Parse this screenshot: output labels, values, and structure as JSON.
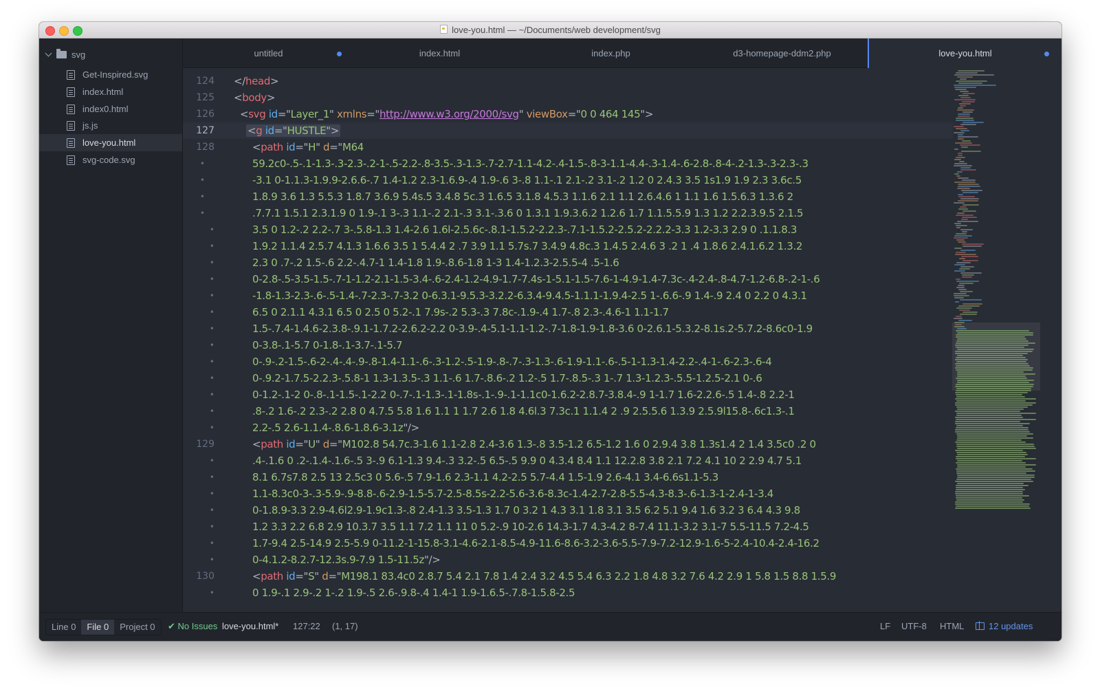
{
  "window": {
    "title": "love-you.html — ~/Documents/web development/svg"
  },
  "sidebar": {
    "root": "svg",
    "items": [
      {
        "label": "Get-Inspired.svg"
      },
      {
        "label": "index.html"
      },
      {
        "label": "index0.html"
      },
      {
        "label": "js.js"
      },
      {
        "label": "love-you.html",
        "selected": true
      },
      {
        "label": "svg-code.svg"
      }
    ]
  },
  "tabs": [
    {
      "label": "untitled",
      "modified": true
    },
    {
      "label": "index.html"
    },
    {
      "label": "index.php"
    },
    {
      "label": "d3-homepage-ddm2.php"
    },
    {
      "label": "love-you.html",
      "modified": true,
      "active": true
    }
  ],
  "editor": {
    "gutter": [
      "124",
      "125",
      "126",
      "127",
      "128",
      "129",
      "130"
    ],
    "current_line": "127",
    "lines": {
      "l0": [
        {
          "cls": "p",
          "text": "</"
        },
        {
          "cls": "t",
          "text": "head"
        },
        {
          "cls": "p",
          "text": ">"
        }
      ],
      "l1": [
        {
          "cls": "p",
          "text": "<"
        },
        {
          "cls": "t",
          "text": "body"
        },
        {
          "cls": "p",
          "text": ">"
        }
      ],
      "l2": [
        {
          "cls": "p",
          "text": "<"
        },
        {
          "cls": "t",
          "text": "svg "
        },
        {
          "cls": "id",
          "text": "id"
        },
        {
          "cls": "p",
          "text": "=\""
        },
        {
          "cls": "g",
          "text": "Layer_1"
        },
        {
          "cls": "p",
          "text": "\" "
        },
        {
          "cls": "a",
          "text": "xmlns"
        },
        {
          "cls": "p",
          "text": "=\""
        },
        {
          "cls": "u",
          "text": "http://www.w3.org/2000/svg"
        },
        {
          "cls": "p",
          "text": "\" "
        },
        {
          "cls": "a",
          "text": "viewBox"
        },
        {
          "cls": "p",
          "text": "=\""
        },
        {
          "cls": "g",
          "text": "0 0 464 145"
        },
        {
          "cls": "p",
          "text": "\">"
        }
      ],
      "l3": [
        {
          "cls": "p",
          "text": "<"
        },
        {
          "cls": "t",
          "text": "g "
        },
        {
          "cls": "id",
          "text": "id"
        },
        {
          "cls": "p",
          "text": "=\""
        },
        {
          "cls": "g",
          "text": "HUSTLE"
        },
        {
          "cls": "p",
          "text": "\">"
        }
      ],
      "l4": [
        {
          "cls": "p",
          "text": "<"
        },
        {
          "cls": "t",
          "text": "path "
        },
        {
          "cls": "id",
          "text": "id"
        },
        {
          "cls": "p",
          "text": "=\""
        },
        {
          "cls": "g",
          "text": "H"
        },
        {
          "cls": "p",
          "text": "\" "
        },
        {
          "cls": "a",
          "text": "d"
        },
        {
          "cls": "p",
          "text": "=\""
        },
        {
          "cls": "g",
          "text": "M64"
        }
      ],
      "l5": [
        {
          "cls": "g",
          "text": "59.2c0-.5-.1-1.3-.3-2.3-.2-1-.5-2.2-.8-3.5-.3-1.3-.7-2.7-1.1-4.2-.4-1.5-.8-3-1.1-4.4-.3-1.4-.6-2.8-.8-4-.2-1.3-.3-2.3-.3"
        }
      ],
      "l6": [
        {
          "cls": "g",
          "text": "-3.1 0-1.1.3-1.9.9-2.6.6-.7 1.4-1.2 2.3-1.6.9-.4 1.9-.6 3-.8 1.1-.1 2.1-.2 3.1-.2 1.2 0 2.4.3 3.5 1s1.9 1.9 2.3 3.6c.5"
        }
      ],
      "l7": [
        {
          "cls": "g",
          "text": "1.8.9 3.6 1.3 5.5.3 1.8.7 3.6.9 5.4s.5 3.4.8 5c.3 1.6.5 3.1.8 4.5.3 1.1.6 2.1 1.1 2.6.4.6 1 1.1 1.6 1.5.6.3 1.3.6 2"
        }
      ],
      "l8": [
        {
          "cls": "g",
          "text": ".7.7.1 1.5.1 2.3.1.9 0 1.9-.1 3-.3 1.1-.2 2.1-.3 3.1-.3.6 0 1.3.1 1.9.3.6.2 1.2.6 1.7 1.1.5.5.9 1.3 1.2 2.2.3.9.5 2.1.5"
        }
      ],
      "l9": [
        {
          "cls": "g",
          "text": "3.5 0 1.2-.2 2.2-.7 3-.5.8-1.3 1.4-2.6 1.6l-2.5.6c-.8.1-1.5.2-2.2.3-.7.1-1.5.2-2.5.2-2.2.2-3.3 1.2-3.3 2.9 0 .1.1.8.3"
        }
      ],
      "l10": [
        {
          "cls": "g",
          "text": "1.9.2 1.1.4 2.5.7 4.1.3 1.6.6 3.5 1 5.4.4 2 .7 3.9 1.1 5.7s.7 3.4.9 4.8c.3 1.4.5 2.4.6 3 .2 1 .4 1.8.6 2.4.1.6.2 1.3.2"
        }
      ],
      "l11": [
        {
          "cls": "g",
          "text": "2.3 0 .7-.2 1.5-.6 2.2-.4.7-1 1.4-1.8 1.9-.8.6-1.8 1-3 1.4-1.2.3-2.5.5-4 .5-1.6"
        }
      ],
      "l12": [
        {
          "cls": "g",
          "text": "0-2.8-.5-3.5-1.5-.7-1-1.2-2.1-1.5-3.4-.6-2.4-1.2-4.9-1.7-7.4s-1-5.1-1.5-7.6-1-4.9-1.4-7.3c-.4-2.4-.8-4.7-1.2-6.8-.2-1-.6"
        }
      ],
      "l13": [
        {
          "cls": "g",
          "text": "-1.8-1.3-2.3-.6-.5-1.4-.7-2.3-.7-3.2 0-6.3.1-9.5.3-3.2.2-6.3.4-9.4.5-1.1.1-1.9.4-2.5 1-.6.6-.9 1.4-.9 2.4 0 2.2 0 4.3.1"
        }
      ],
      "l14": [
        {
          "cls": "g",
          "text": "6.5 0 2.1.1 4.3.1 6.5 0 2.5 0 5.2-.1 7.9s-.2 5.3-.3 7.8c-.1.9-.4 1.7-.8 2.3-.4.6-1 1.1-1.7"
        }
      ],
      "l15": [
        {
          "cls": "g",
          "text": "1.5-.7.4-1.4.6-2.3.8-.9.1-1.7.2-2.6.2-2.2 0-3.9-.4-5.1-1.1-1.2-.7-1.8-1.9-1.8-3.6 0-2.6.1-5.3.2-8.1s.2-5.7.2-8.6c0-1.9"
        }
      ],
      "l16": [
        {
          "cls": "g",
          "text": "0-3.8-.1-5.7 0-1.8-.1-3.7-.1-5.7"
        }
      ],
      "l17": [
        {
          "cls": "g",
          "text": "0-.9-.2-1.5-.6-2-.4-.4-.9-.8-1.4-1.1-.6-.3-1.2-.5-1.9-.8-.7-.3-1.3-.6-1.9-1.1-.6-.5-1-1.3-1.4-2.2-.4-1-.6-2.3-.6-4"
        }
      ],
      "l18": [
        {
          "cls": "g",
          "text": "0-.9.2-1.7.5-2.2.3-.5.8-1 1.3-1.3.5-.3 1.1-.6 1.7-.8.6-.2 1.2-.5 1.7-.8.5-.3 1-.7 1.3-1.2.3-.5.5-1.2.5-2.1 0-.6"
        }
      ],
      "l19": [
        {
          "cls": "g",
          "text": "0-1.2-.1-2 0-.8-.1-1.5-.1-2.2 0-.7-.1-1.3-.1-1.8s-.1-.9-.1-1.1c0-1.6.2-2.8.7-3.8.4-.9 1-1.7 1.6-2.2.6-.5 1.4-.8 2.2-1"
        }
      ],
      "l20": [
        {
          "cls": "g",
          "text": ".8-.2 1.6-.2 2.3-.2 2.8 0 4.7.5 5.8 1.6 1.1 1 1.7 2.6 1.8 4.6l.3 7.3c.1 1.1.4 2 .9 2.5.5.6 1.3.9 2.5.9l15.8-.6c1.3-.1"
        }
      ],
      "l21": [
        {
          "cls": "g",
          "text": "2.2-.5 2.6-1.1.4-.8.6-1.8.6-3.1z"
        },
        {
          "cls": "p",
          "text": "\"/>"
        }
      ],
      "l22": [
        {
          "cls": "p",
          "text": "<"
        },
        {
          "cls": "t",
          "text": "path "
        },
        {
          "cls": "id",
          "text": "id"
        },
        {
          "cls": "p",
          "text": "=\""
        },
        {
          "cls": "g",
          "text": "U"
        },
        {
          "cls": "p",
          "text": "\" "
        },
        {
          "cls": "a",
          "text": "d"
        },
        {
          "cls": "p",
          "text": "=\""
        },
        {
          "cls": "g",
          "text": "M102.8 54.7c.3-1.6 1.1-2.8 2.4-3.6 1.3-.8 3.5-1.2 6.5-1.2 1.6 0 2.9.4 3.8 1.3s1.4 2 1.4 3.5c0 .2 0"
        }
      ],
      "l23": [
        {
          "cls": "g",
          "text": ".4-.1.6 0 .2-.1.4-.1.6-.5 3-.9 6.1-1.3 9.4-.3 3.2-.5 6.5-.5 9.9 0 4.3.4 8.4 1.1 12.2.8 3.8 2.1 7.2 4.1 10 2 2.9 4.7 5.1"
        }
      ],
      "l24": [
        {
          "cls": "g",
          "text": "8.1 6.7s7.8 2.5 13 2.5c3 0 5.6-.5 7.9-1.6 2.3-1.1 4.2-2.5 5.7-4.4 1.5-1.9 2.6-4.1 3.4-6.6s1.1-5.3"
        }
      ],
      "l25": [
        {
          "cls": "g",
          "text": "1.1-8.3c0-3-.3-5.9-.9-8.8-.6-2.9-1.5-5.7-2.5-8.5s-2.2-5.6-3.6-8.3c-1.4-2.7-2.8-5.5-4.3-8.3-.6-1.3-1-2.4-1-3.4"
        }
      ],
      "l26": [
        {
          "cls": "g",
          "text": "0-1.8.9-3.3 2.9-4.6l2.9-1.9c1.3-.8 2.4-1.3 3.5-1.3 1.7 0 3.2 1 4.3 3.1 1.8 3.1 3.5 6.2 5.1 9.4 1.6 3.2 3 6.4 4.3 9.8"
        }
      ],
      "l27": [
        {
          "cls": "g",
          "text": "1.2 3.3 2.2 6.8 2.9 10.3.7 3.5 1.1 7.2 1.1 11 0 5.2-.9 10-2.6 14.3-1.7 4.3-4.2 8-7.4 11.1-3.2 3.1-7 5.5-11.5 7.2-4.5"
        }
      ],
      "l28": [
        {
          "cls": "g",
          "text": "1.7-9.4 2.5-14.9 2.5-5.9 0-11.2-1-15.8-3.1-4.6-2.1-8.5-4.9-11.6-8.6-3.2-3.6-5.5-7.9-7.2-12.9-1.6-5-2.4-10.4-2.4-16.2"
        }
      ],
      "l29": [
        {
          "cls": "g",
          "text": "0-4.1.2-8.2.7-12.3s.9-7.9 1.5-11.5z"
        },
        {
          "cls": "p",
          "text": "\"/>"
        }
      ],
      "l30": [
        {
          "cls": "p",
          "text": "<"
        },
        {
          "cls": "t",
          "text": "path "
        },
        {
          "cls": "id",
          "text": "id"
        },
        {
          "cls": "p",
          "text": "=\""
        },
        {
          "cls": "g",
          "text": "S"
        },
        {
          "cls": "p",
          "text": "\" "
        },
        {
          "cls": "a",
          "text": "d"
        },
        {
          "cls": "p",
          "text": "=\""
        },
        {
          "cls": "g",
          "text": "M198.1 83.4c0 2.8.7 5.4 2.1 7.8 1.4 2.4 3.2 4.5 5.4 6.3 2.2 1.8 4.8 3.2 7.6 4.2 2.9 1 5.8 1.5 8.8 1.5.9"
        }
      ],
      "l31": [
        {
          "cls": "g",
          "text": "0 1.9-.1 2.9-.2 1-.2 1.9-.5 2.6-.9.8-.4 1.4-1 1.9-1.6.5-.7.8-1.5.8-2.5"
        }
      ]
    }
  },
  "status": {
    "line_btn": "Line 0",
    "file_btn": "File 0",
    "project_btn": "Project 0",
    "issues": "No Issues",
    "file": "love-you.html*",
    "cursor": "127:22",
    "selection": "(1, 17)",
    "eol": "LF",
    "encoding": "UTF-8",
    "grammar": "HTML",
    "updates": "12 updates"
  }
}
